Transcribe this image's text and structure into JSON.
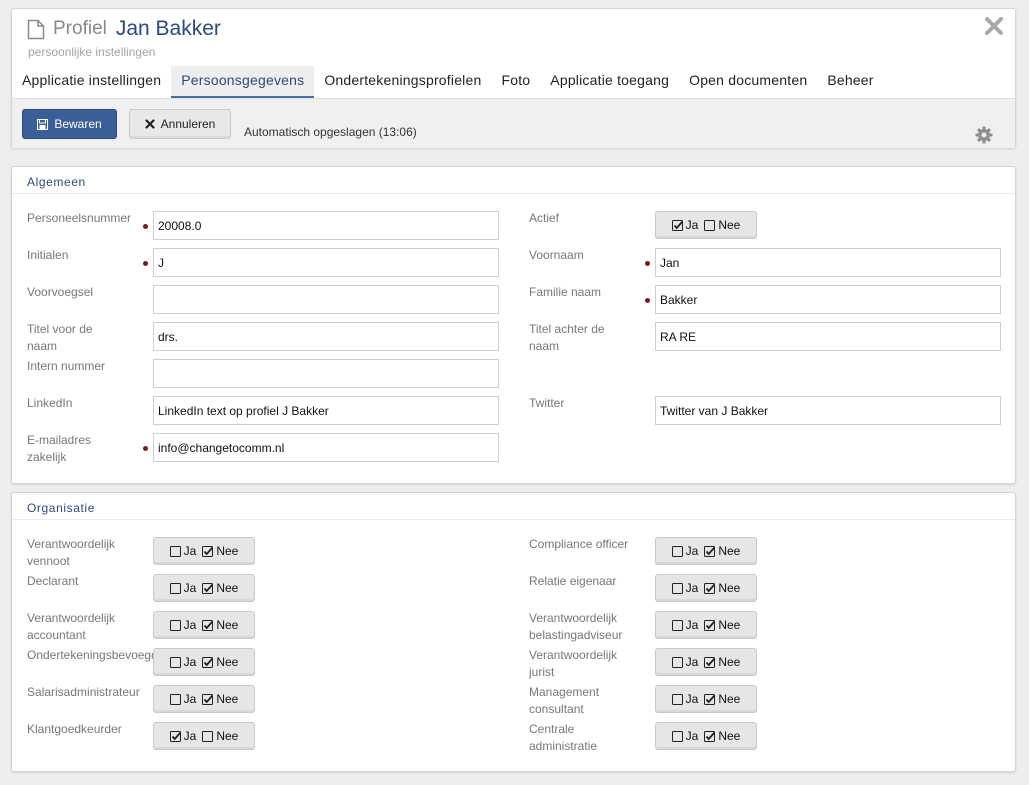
{
  "header": {
    "title_prefix": "Profiel",
    "title_name": "Jan Bakker",
    "subtitle": "persoonlijke instellingen"
  },
  "tabs": [
    {
      "label": "Applicatie instellingen",
      "active": false
    },
    {
      "label": "Persoonsgegevens",
      "active": true
    },
    {
      "label": "Ondertekeningsprofielen",
      "active": false
    },
    {
      "label": "Foto",
      "active": false
    },
    {
      "label": "Applicatie toegang",
      "active": false
    },
    {
      "label": "Open documenten",
      "active": false
    },
    {
      "label": "Beheer",
      "active": false
    }
  ],
  "toolbar": {
    "save_label": "Bewaren",
    "cancel_label": "Annuleren",
    "autosave_status": "Automatisch opgeslagen (13:06)"
  },
  "algemeen": {
    "title": "Algemeen",
    "personeelsnummer": {
      "label": "Personeelsnummer",
      "value": "20008.0",
      "required": true
    },
    "initialen": {
      "label": "Initialen",
      "value": "J",
      "required": true
    },
    "voorvoegsel": {
      "label": "Voorvoegsel",
      "value": "",
      "required": false
    },
    "titel_voor": {
      "label": "Titel voor de naam",
      "value": "drs.",
      "required": false
    },
    "intern_nummer": {
      "label": "Intern nummer",
      "value": "",
      "required": false
    },
    "linkedin": {
      "label": "LinkedIn",
      "value": "LinkedIn text op profiel J Bakker",
      "required": false
    },
    "email": {
      "label": "E-mailadres zakelijk",
      "value": "info@changetocomm.nl",
      "required": true
    },
    "actief": {
      "label": "Actief",
      "yes": "Ja",
      "no": "Nee",
      "value": true
    },
    "voornaam": {
      "label": "Voornaam",
      "value": "Jan",
      "required": true
    },
    "familienaam": {
      "label": "Familie naam",
      "value": "Bakker",
      "required": true
    },
    "titel_achter": {
      "label": "Titel achter de naam",
      "value": "RA RE",
      "required": false
    },
    "twitter": {
      "label": "Twitter",
      "value": "Twitter van J Bakker",
      "required": false
    }
  },
  "organisatie": {
    "title": "Organisatie",
    "yes_label": "Ja",
    "no_label": "Nee",
    "left": [
      {
        "label": "Verantwoordelijk vennoot",
        "value": false
      },
      {
        "label": "Declarant",
        "value": false
      },
      {
        "label": "Verantwoordelijk accountant",
        "value": false
      },
      {
        "label": "Ondertekeningsbevoegd",
        "value": false
      },
      {
        "label": "Salarisadministrateur",
        "value": false
      },
      {
        "label": "Klantgoedkeurder",
        "value": true
      }
    ],
    "right": [
      {
        "label": "Compliance officer",
        "value": false
      },
      {
        "label": "Relatie eigenaar",
        "value": false
      },
      {
        "label": "Verantwoordelijk belastingadviseur",
        "value": false
      },
      {
        "label": "Verantwoordelijk jurist",
        "value": false
      },
      {
        "label": "Management consultant",
        "value": false
      },
      {
        "label": "Centrale administratie",
        "value": false
      }
    ]
  },
  "colors": {
    "accent": "#2b4a7e",
    "primary_button": "#3a5f98",
    "required_dot": "#7a1b1b",
    "background": "#eeeeee"
  },
  "icons": {
    "title": "document-icon",
    "close": "close-icon",
    "save": "floppy-disk-icon",
    "cancel": "x-mark-icon",
    "settings": "gear-icon"
  }
}
